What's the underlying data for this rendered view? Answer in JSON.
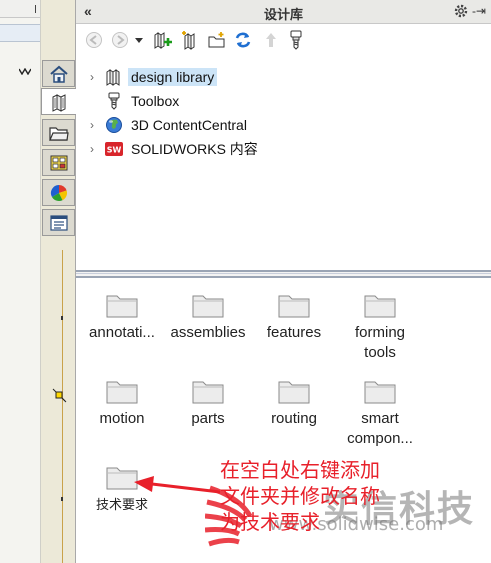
{
  "panel": {
    "title": "设计库",
    "collapse_glyph": "«",
    "pin_glyph": "-⇥"
  },
  "toolbar": {
    "buttons": [
      "back-icon",
      "forward-icon",
      "dropdown-icon",
      "add-to-library-icon",
      "add-file-location-icon",
      "create-new-folder-icon",
      "refresh-icon",
      "up-one-level-icon",
      "design-library-options-icon"
    ]
  },
  "tree": {
    "items": [
      {
        "label": "design library",
        "expandable": true,
        "selected": true,
        "icon": "library-books-icon"
      },
      {
        "label": "Toolbox",
        "expandable": false,
        "selected": false,
        "icon": "toolbox-screw-icon"
      },
      {
        "label": "3D ContentCentral",
        "expandable": true,
        "selected": false,
        "icon": "globe-icon"
      },
      {
        "label": "SOLIDWORKS 内容",
        "expandable": true,
        "selected": false,
        "icon": "solidworks-logo-icon"
      }
    ]
  },
  "folders": [
    {
      "label": "annotati..."
    },
    {
      "label": "assemblies"
    },
    {
      "label": "features"
    },
    {
      "label": "forming\ntools"
    },
    {
      "label": "motion"
    },
    {
      "label": "parts"
    },
    {
      "label": "routing"
    },
    {
      "label": "smart\ncompon..."
    },
    {
      "label": "技术要求"
    }
  ],
  "side_tabs": [
    "home-icon",
    "design-library-icon",
    "file-explorer-icon",
    "view-palette-icon",
    "appearances-icon",
    "custom-properties-icon"
  ],
  "annotation": {
    "lines": [
      "在空白处右键添加",
      "文件夹并修改名称",
      "为技术要求"
    ],
    "color": "#e8202a"
  },
  "watermark": {
    "text": "实信科技",
    "url": "www.solidwise.com"
  },
  "colors": {
    "selection": "#cce4f7",
    "splitter": "#9aa4b4",
    "annotation_red": "#e8202a"
  }
}
